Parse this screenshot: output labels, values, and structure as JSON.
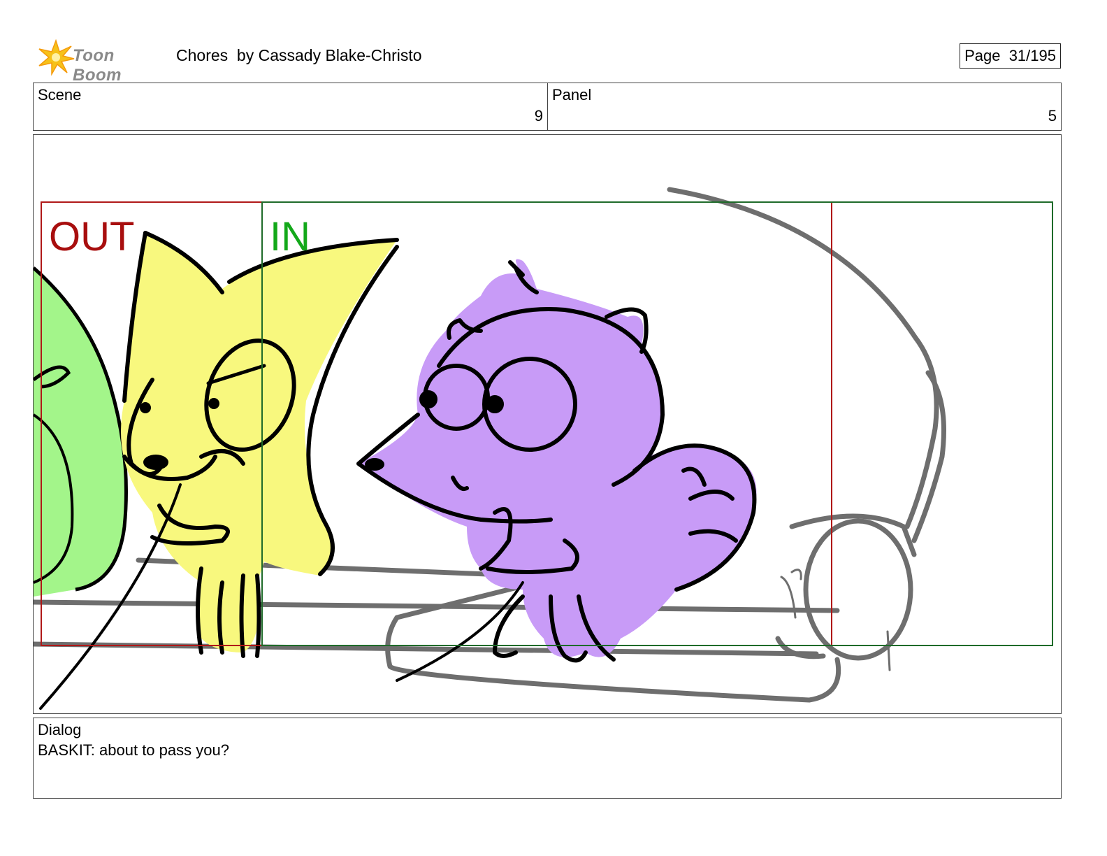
{
  "header": {
    "logo_text": "Toon Boom",
    "title": "Chores  by Cassady Blake-Christo",
    "page": "Page  31/195"
  },
  "info": {
    "scene_label": "Scene",
    "scene_value": "9",
    "panel_label": "Panel",
    "panel_value": "5"
  },
  "panel": {
    "out_label": "OUT",
    "in_label": "IN",
    "colors": {
      "out_frame": "#b01818",
      "in_frame": "#1f6b2a",
      "out_text": "#a80e0e",
      "in_text": "#13a81a",
      "yellow_character": "#f8f87e",
      "purple_character": "#c89bf7",
      "green_character": "#a3f58a",
      "couch_stroke": "#6e6e6e"
    }
  },
  "dialog": {
    "label": "Dialog",
    "text": "BASKIT: about to pass you?"
  }
}
